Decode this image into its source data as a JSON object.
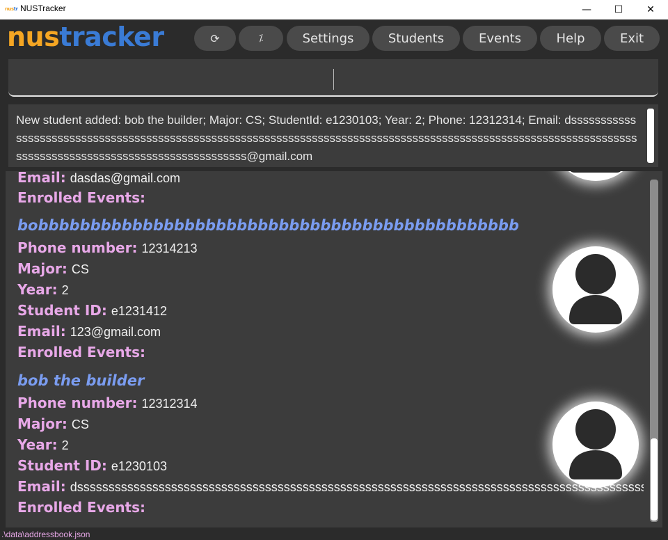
{
  "window": {
    "title": "NUSTracker",
    "minimize_glyph": "—",
    "maximize_glyph": "☐",
    "close_glyph": "✕"
  },
  "logo": {
    "part1": "nus",
    "part2": "tracker"
  },
  "toolbar": {
    "refresh_glyph": "⟳",
    "toggle_glyph": "⁒",
    "settings_label": "Settings",
    "students_label": "Students",
    "events_label": "Events",
    "help_label": "Help",
    "exit_label": "Exit"
  },
  "command": {
    "value": ""
  },
  "result": {
    "message": "New student added: bob the builder; Major: CS; StudentId: e1230103; Year: 2; Phone: 12312314; Email: dsssssssssssssssssssssssssssssssssssssssssssssssssssssssssssssssssssssssssssssssssssssssssssssssssssssssssssssssssssssssssssssssssssssssssssssssssssssssssss@gmail.com"
  },
  "labels": {
    "phone": "Phone number:",
    "major": "Major:",
    "year": "Year:",
    "student_id": "Student ID:",
    "email": "Email:",
    "enrolled": "Enrolled Events:"
  },
  "students": [
    {
      "email": "dasdas@gmail.com"
    },
    {
      "name": "bobbbbbbbbbbbbbbbbbbbbbbbbbbbbbbbbbbbbbbbbbbbbbb",
      "phone": "12314213",
      "major": "CS",
      "year": "2",
      "student_id": "e1231412",
      "email": "123@gmail.com"
    },
    {
      "name": "bob the builder",
      "phone": "12312314",
      "major": "CS",
      "year": "2",
      "student_id": "e1230103",
      "email": "dsssssssssssssssssssssssssssssssssssssssssssssssssssssssssssssssssssssssssssssssssssssssssssssssss"
    }
  ],
  "status": {
    "file_path": ".\\data\\addressbook.json"
  },
  "colors": {
    "accent_orange": "#f5a623",
    "accent_blue": "#3a7bd5",
    "name_blue": "#7a9cf0",
    "label_pink": "#e8a8e8",
    "background": "#2b2b2b",
    "panel": "#3c3c3c"
  }
}
